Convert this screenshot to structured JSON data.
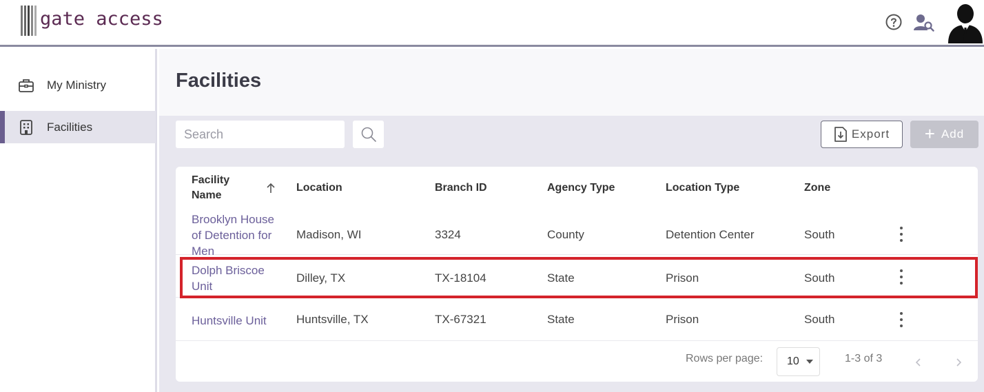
{
  "app": {
    "name": "gate access",
    "brand_color": "#5b2a52",
    "accent_color": "#6a5e8e"
  },
  "header": {
    "icons": [
      "help-circle-icon",
      "user-search-icon",
      "user-avatar"
    ]
  },
  "sidebar": {
    "items": [
      {
        "label": "My Ministry",
        "icon": "briefcase-icon",
        "active": false
      },
      {
        "label": "Facilities",
        "icon": "building-icon",
        "active": true
      }
    ]
  },
  "main": {
    "title": "Facilities",
    "search": {
      "placeholder": "Search",
      "value": ""
    },
    "export_label": "Export",
    "add_label": "Add",
    "table": {
      "columns": [
        "Facility Name",
        "Location",
        "Branch ID",
        "Agency Type",
        "Location Type",
        "Zone"
      ],
      "sort": {
        "column": "Facility Name",
        "direction": "ascending"
      },
      "rows": [
        {
          "facility": "Brooklyn House of Detention for Men",
          "location": "Madison, WI",
          "branch_id": "3324",
          "agency_type": "County",
          "location_type": "Detention Center",
          "zone": "South"
        },
        {
          "facility": "Dolph Briscoe Unit",
          "location": "Dilley, TX",
          "branch_id": "TX-18104",
          "agency_type": "State",
          "location_type": "Prison",
          "zone": "South",
          "highlighted": true
        },
        {
          "facility": "Huntsville Unit",
          "location": "Huntsville, TX",
          "branch_id": "TX-67321",
          "agency_type": "State",
          "location_type": "Prison",
          "zone": "South"
        }
      ]
    },
    "pagination": {
      "rows_per_page_label": "Rows per page:",
      "rows_per_page": "10",
      "range": "1-3 of 3"
    }
  },
  "highlight_color": "#d4232b"
}
